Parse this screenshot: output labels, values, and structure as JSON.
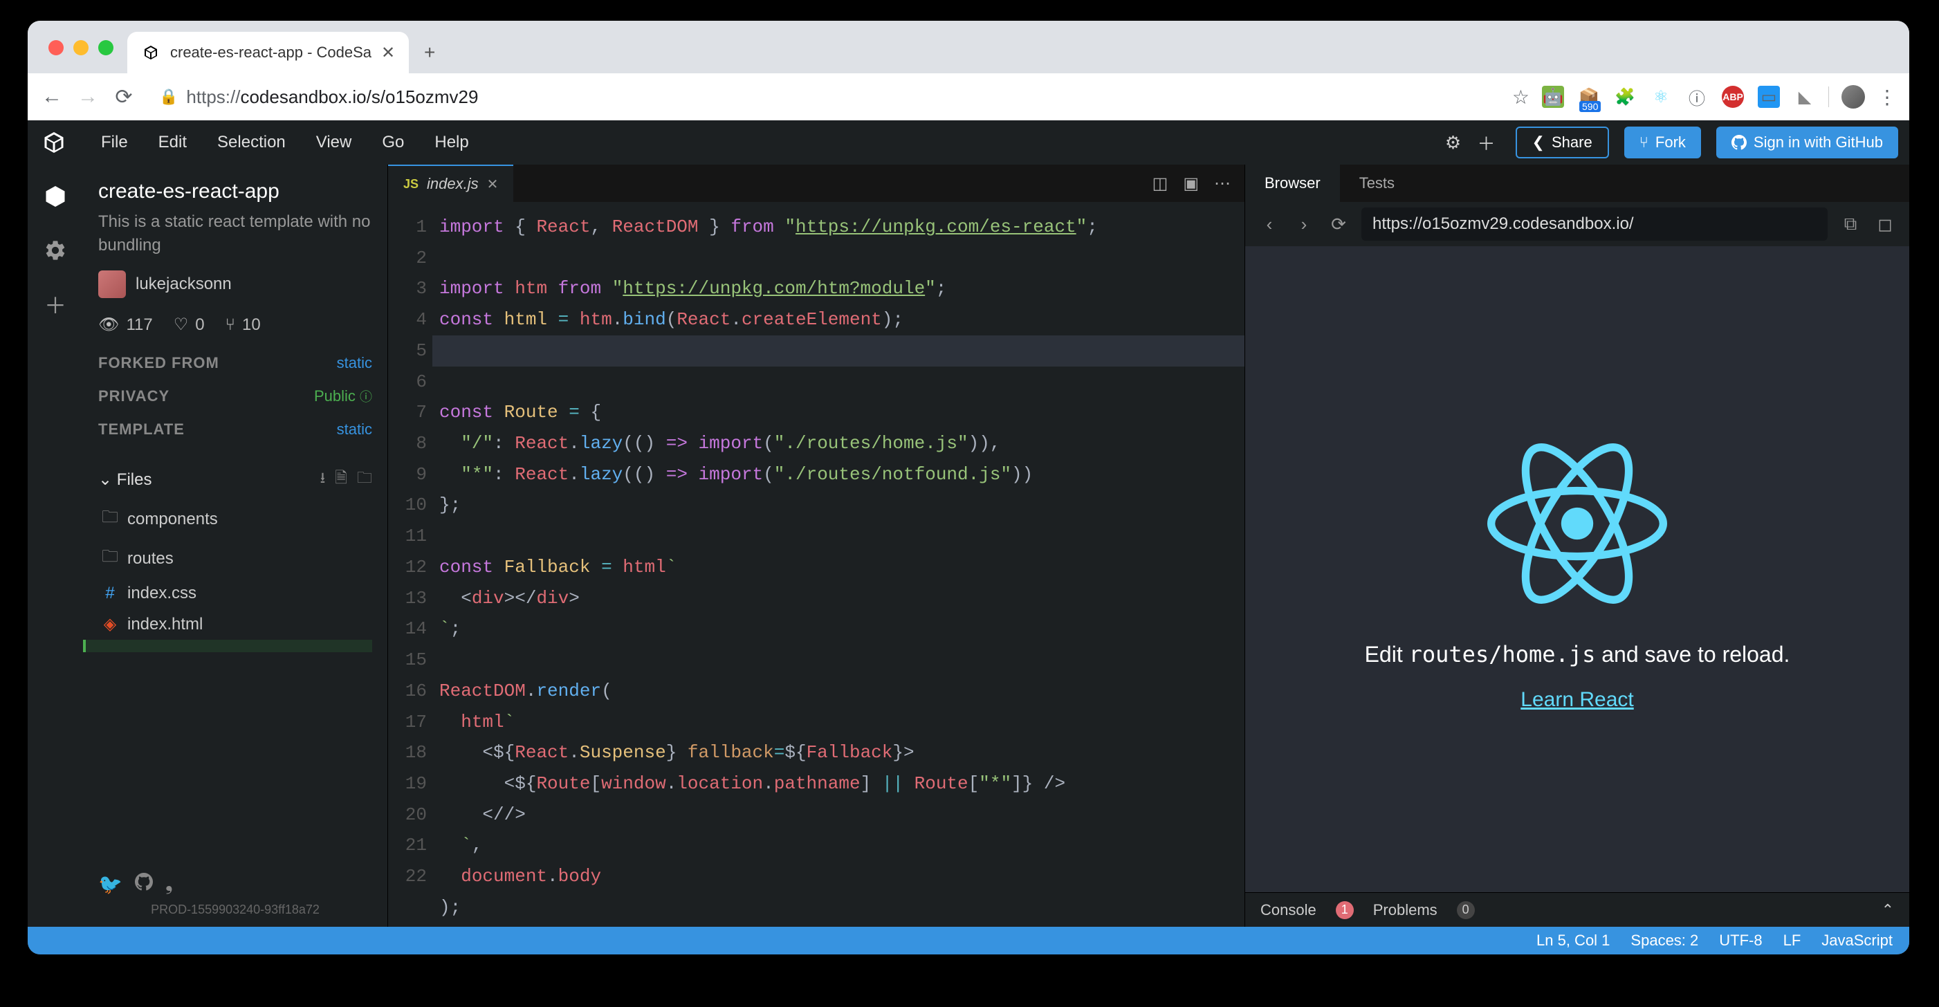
{
  "browser": {
    "tab_title": "create-es-react-app - CodeSa",
    "url_proto": "https://",
    "url_rest": "codesandbox.io/s/o15ozmv29",
    "extension_badge": "590"
  },
  "menubar": {
    "items": [
      "File",
      "Edit",
      "Selection",
      "View",
      "Go",
      "Help"
    ],
    "share": "Share",
    "fork": "Fork",
    "signin": "Sign in with GitHub"
  },
  "sidebar": {
    "project_title": "create-es-react-app",
    "project_desc": "This is a static react template with no bundling",
    "username": "lukejacksonn",
    "stats": {
      "views": "117",
      "likes": "0",
      "forks": "10"
    },
    "forked_label": "FORKED FROM",
    "forked_value": "static",
    "privacy_label": "PRIVACY",
    "privacy_value": "Public",
    "template_label": "TEMPLATE",
    "template_value": "static",
    "files_label": "Files",
    "files": [
      {
        "name": "components",
        "type": "folder"
      },
      {
        "name": "routes",
        "type": "folder"
      },
      {
        "name": "index.css",
        "type": "css"
      },
      {
        "name": "index.html",
        "type": "html"
      }
    ],
    "build": "PROD-1559903240-93ff18a72"
  },
  "editor": {
    "tab_filename": "index.js",
    "line_numbers": [
      "1",
      "2",
      "3",
      "4",
      "5",
      "6",
      "7",
      "8",
      "9",
      "10",
      "11",
      "12",
      "13",
      "14",
      "15",
      "16",
      "17",
      "18",
      "19",
      "20",
      "21",
      "22"
    ]
  },
  "preview": {
    "tab_browser": "Browser",
    "tab_tests": "Tests",
    "url": "https://o15ozmv29.codesandbox.io/",
    "text_pre": "Edit ",
    "text_code": "routes/home.js",
    "text_post": " and save to reload.",
    "link": "Learn React",
    "console_label": "Console",
    "console_count": "1",
    "problems_label": "Problems",
    "problems_count": "0"
  },
  "statusbar": {
    "cursor": "Ln 5, Col 1",
    "spaces": "Spaces: 2",
    "encoding": "UTF-8",
    "eol": "LF",
    "lang": "JavaScript"
  }
}
